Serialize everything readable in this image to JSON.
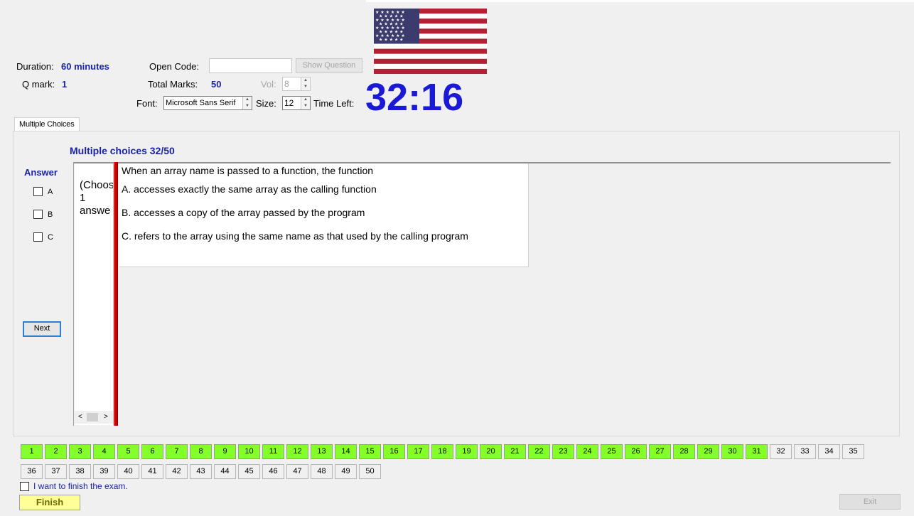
{
  "header": {
    "duration_label": "Duration:",
    "duration_value": "60 minutes",
    "qmark_label": "Q mark:",
    "qmark_value": "1",
    "open_code_label": "Open Code:",
    "open_code_value": "",
    "show_question_label": "Show Question",
    "total_marks_label": "Total Marks:",
    "total_marks_value": "50",
    "vol_label": "Vol:",
    "vol_value": "8",
    "font_label": "Font:",
    "font_value": "Microsoft Sans Serif",
    "size_label": "Size:",
    "size_value": "12",
    "time_left_label": "Time Left:",
    "time_left_value": "32:16",
    "flag_icon": "us-flag-icon"
  },
  "tabs": [
    {
      "label": "Multiple Choices"
    }
  ],
  "question_panel": {
    "title": "Multiple choices 32/50",
    "answer_label": "Answer",
    "options": [
      {
        "label": "A",
        "checked": false
      },
      {
        "label": "B",
        "checked": false
      },
      {
        "label": "C",
        "checked": false
      }
    ],
    "next_label": "Next",
    "instruction_line1": "(Choos",
    "instruction_line2": "1",
    "instruction_line3": "answe",
    "question_text": "When an array name is passed to a function, the function",
    "answers": [
      "A.  accesses exactly the same array as the calling function",
      "B.  accesses a copy of the array passed by the program",
      "C.  refers to the array using the same name as that used by the calling program"
    ]
  },
  "question_numbers": {
    "row1": [
      "1",
      "2",
      "3",
      "4",
      "5",
      "6",
      "7",
      "8",
      "9",
      "10",
      "11",
      "12",
      "13",
      "14",
      "15",
      "16",
      "17",
      "18",
      "19",
      "20",
      "21",
      "22",
      "23",
      "24",
      "25",
      "26",
      "27",
      "28",
      "29",
      "30",
      "31",
      "32",
      "33",
      "34",
      "35"
    ],
    "row2": [
      "36",
      "37",
      "38",
      "39",
      "40",
      "41",
      "42",
      "43",
      "44",
      "45",
      "46",
      "47",
      "48",
      "49",
      "50"
    ],
    "answered_count": 31
  },
  "footer": {
    "finish_checkbox_label": "I want to finish the exam.",
    "finish_checked": false,
    "finish_label": "Finish",
    "exit_label": "Exit"
  },
  "colors": {
    "accent_blue": "#1a22a8",
    "timer_blue": "#1a1ad6",
    "answered_green": "#84ff2a",
    "finish_yellow": "#ffff99",
    "divider_red": "#cc0000"
  }
}
